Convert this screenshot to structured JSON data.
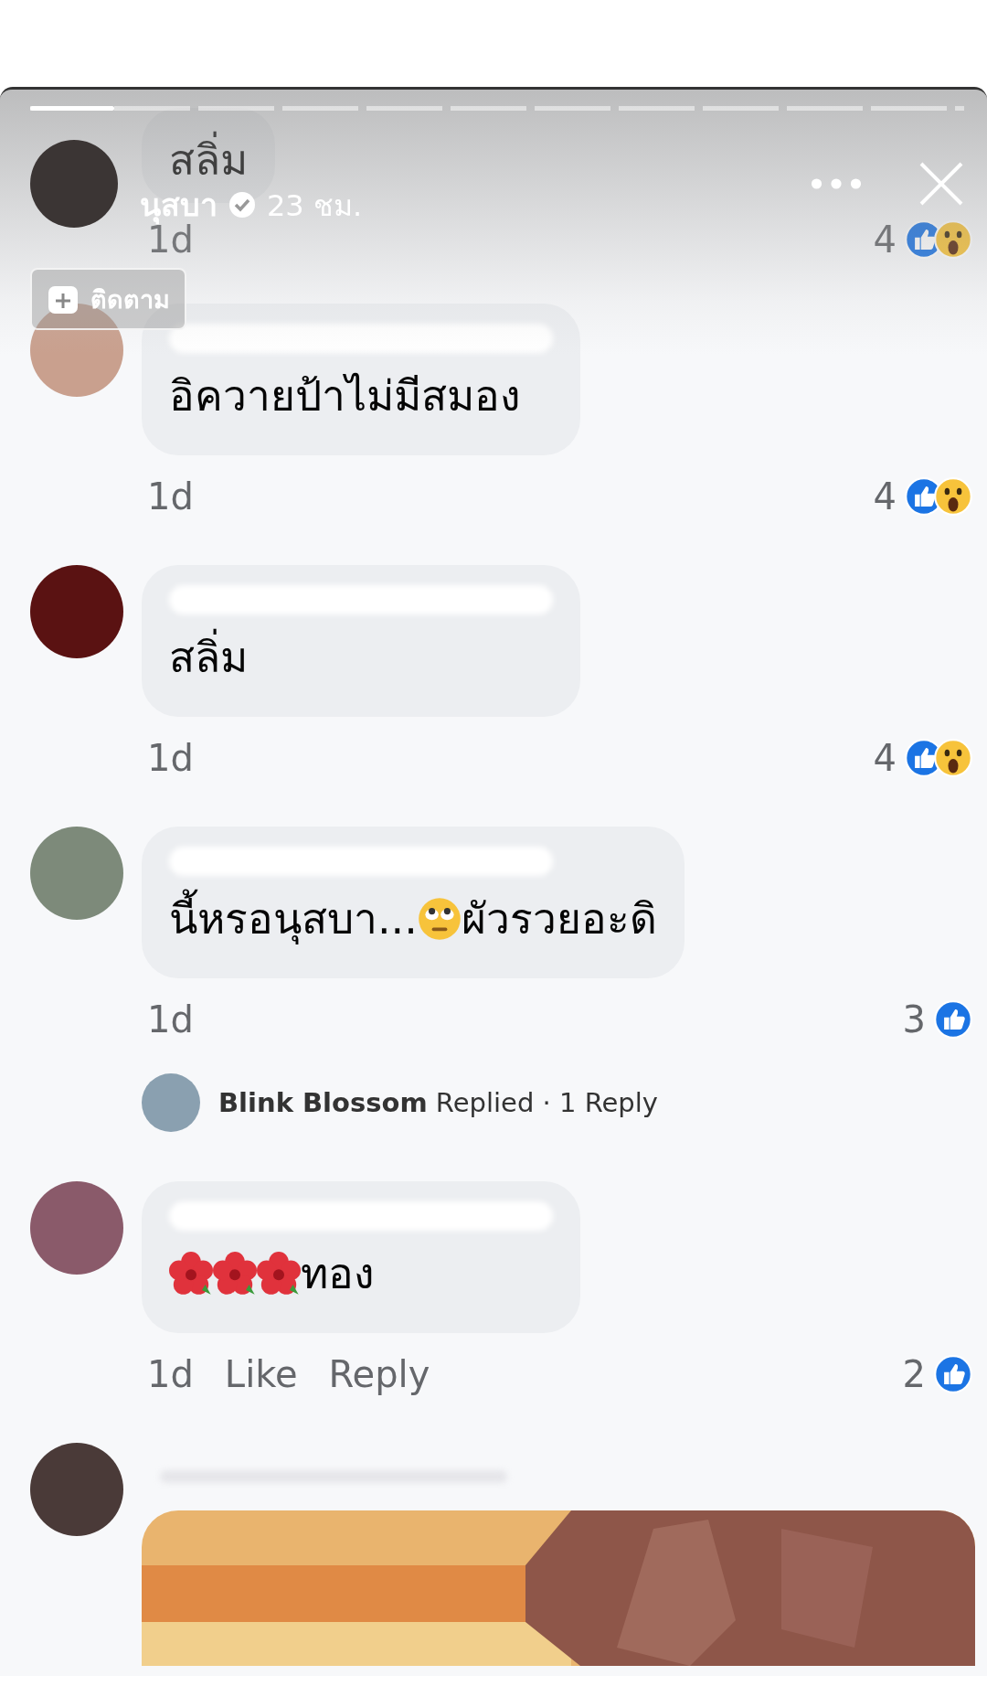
{
  "story": {
    "progress": {
      "level": 0.09
    },
    "author": "นุสบา",
    "verified": true,
    "time": "23 ชม.",
    "follow_label": "ติดตาม"
  },
  "comments": [
    {
      "avatar": false,
      "redacted_name": false,
      "parts": [
        {
          "kind": "text",
          "text": "สลิ่ม"
        }
      ],
      "sticker": false,
      "time": "1d",
      "reaction_count": "4",
      "reactions": [
        {
          "kind": "like"
        },
        {
          "kind": "wow"
        }
      ]
    },
    {
      "avatar": true,
      "redacted_name": true,
      "parts": [
        {
          "kind": "text",
          "text": "อิควายป้าไม่มีสมอง"
        }
      ],
      "sticker": false,
      "time": "1d",
      "reaction_count": "4",
      "reactions": [
        {
          "kind": "like"
        },
        {
          "kind": "wow"
        }
      ]
    },
    {
      "avatar": true,
      "redacted_name": true,
      "parts": [
        {
          "kind": "text",
          "text": "สลิ่ม"
        }
      ],
      "sticker": false,
      "time": "1d",
      "reaction_count": "4",
      "reactions": [
        {
          "kind": "like"
        },
        {
          "kind": "wow"
        }
      ]
    },
    {
      "avatar": true,
      "redacted_name": true,
      "parts": [
        {
          "kind": "text",
          "text": "นี้หรอนุสบา..."
        },
        {
          "kind": "eyeroll"
        },
        {
          "kind": "text",
          "text": "ผัวรวยอะดิ"
        }
      ],
      "sticker": false,
      "time": "1d",
      "reaction_count": "3",
      "reactions": [
        {
          "kind": "like"
        }
      ],
      "reply": {
        "text": "**Blink Blossom** Replied · 1 Reply"
      }
    },
    {
      "avatar": true,
      "redacted_name": true,
      "parts": [
        {
          "kind": "flower"
        },
        {
          "kind": "flower"
        },
        {
          "kind": "flower"
        },
        {
          "kind": "text",
          "text": "ทอง"
        }
      ],
      "sticker": false,
      "time": "1d",
      "actions": [
        "Like",
        "Reply"
      ],
      "reaction_count": "2",
      "reactions": [
        {
          "kind": "like"
        }
      ]
    },
    {
      "avatar": true,
      "redacted_name": true,
      "sticker": true
    }
  ]
}
